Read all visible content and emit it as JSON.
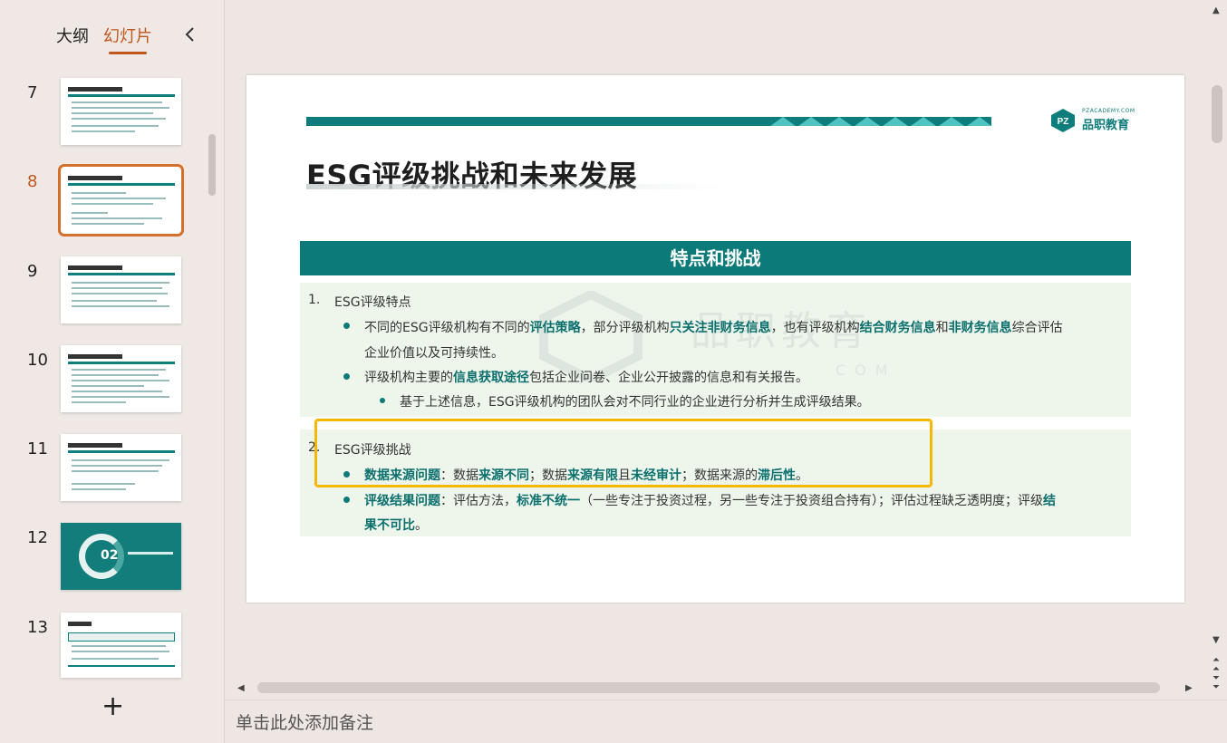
{
  "panel": {
    "tab_outline": "大纲",
    "tab_slides": "幻灯片",
    "collapse_icon": "chevron-left-icon"
  },
  "thumbnails": [
    {
      "num": "7"
    },
    {
      "num": "8"
    },
    {
      "num": "9"
    },
    {
      "num": "10"
    },
    {
      "num": "11"
    },
    {
      "num": "12",
      "label": "02"
    },
    {
      "num": "13"
    }
  ],
  "add_slide": "+",
  "notes_placeholder": "单击此处添加备注",
  "slide": {
    "logo_small": "PZACADEMY.COM",
    "logo_brand": "品职教育",
    "title": "ESG评级挑战和未来发展",
    "section_header": "特点和挑战",
    "watermark_cn": "品职教育",
    "watermark_en": "COM",
    "item1_num": "1.",
    "item1_title": "ESG评级特点",
    "b1_p1": "不同的ESG评级机构有不同的",
    "b1_h1": "评估策略",
    "b1_p2": "，部分评级机构",
    "b1_h2": "只关注非财务信息",
    "b1_p3": "，也有评级机构",
    "b1_h3": "结合财务信息",
    "b1_p4": "和",
    "b1_h4": "非财务信息",
    "b1_p5": "综合评估",
    "b1_line2": "企业价值以及可持续性。",
    "b2_p1": "评级机构主要的",
    "b2_h1": "信息获取途径",
    "b2_p2": "包括企业问卷、企业公开披露的信息和有关报告。",
    "b3": "基于上述信息，ESG评级机构的团队会对不同行业的企业进行分析并生成评级结果。",
    "item2_num": "2.",
    "item2_title": "ESG评级挑战",
    "c1_h1": "数据来源问题",
    "c1_p1": "：数据",
    "c1_h2": "来源不同",
    "c1_p2": "；数据",
    "c1_h3": "来源有限",
    "c1_p3": "且",
    "c1_h4": "未经审计",
    "c1_p4": "；数据来源的",
    "c1_h5": "滞后性",
    "c1_p5": "。",
    "c2_h1": "评级结果问题",
    "c2_p1": "：评估方法，",
    "c2_h2": "标准不统一",
    "c2_p2": "（一些专注于投资过程，另一些专注于投资组合持有）；评估过程缺乏透明度；评级",
    "c2_h3": "结",
    "c2_h4": "果不可比",
    "c2_p3": "。"
  },
  "colors": {
    "accent": "#c0561a",
    "teal": "#0b7a78",
    "highlight": "#f5b800"
  }
}
